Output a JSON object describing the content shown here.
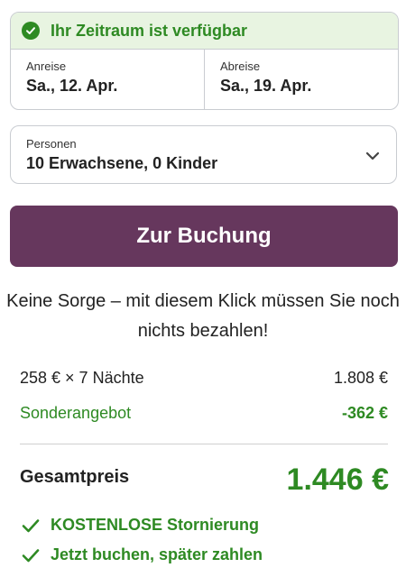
{
  "availability": {
    "text": "Ihr Zeitraum ist verfügbar"
  },
  "dates": {
    "arrival": {
      "label": "Anreise",
      "value": "Sa., 12. Apr."
    },
    "departure": {
      "label": "Abreise",
      "value": "Sa., 19. Apr."
    }
  },
  "persons": {
    "label": "Personen",
    "value": "10 Erwachsene, 0 Kinder"
  },
  "cta": {
    "label": "Zur Buchung"
  },
  "notice": "Keine Sorge – mit diesem Klick müssen Sie noch nichts bezahlen!",
  "pricing": {
    "nights_label": "258 € × 7 Nächte",
    "nights_amount": "1.808 €",
    "offer_label": "Sonderangebot",
    "offer_amount": "-362 €",
    "total_label": "Gesamtpreis",
    "total_amount": "1.446 €"
  },
  "benefits": [
    {
      "text": "KOSTENLOSE Stornierung",
      "icon": "checkmark-icon"
    },
    {
      "text": "Jetzt buchen, später zahlen",
      "icon": "checkmark-icon"
    }
  ],
  "colors": {
    "accent": "#66375d",
    "success": "#2e8a23",
    "success_bg": "#e8f4e1",
    "border": "#c9ccd1"
  }
}
